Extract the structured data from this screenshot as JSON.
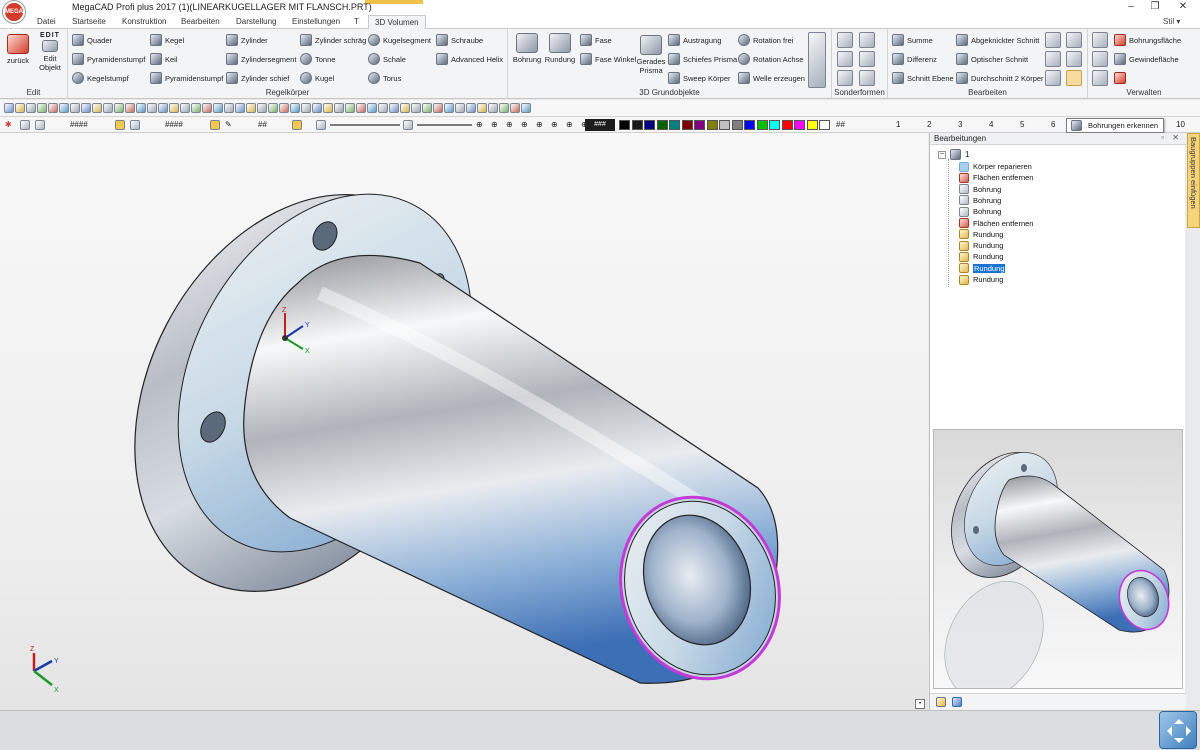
{
  "app": {
    "logo": "MEGA CAD",
    "title": "MegaCAD Profi plus 2017 (1)(LINEARKUGELLAGER MIT FLANSCH.PRT)",
    "window_buttons": [
      "–",
      "❐",
      "✕"
    ]
  },
  "menu": {
    "tabs": [
      "Datei",
      "Startseite",
      "Konstruktion",
      "Bearbeiten",
      "Darstellung",
      "Einstellungen",
      "T",
      "3D Volumen"
    ],
    "active_tab": "3D Volumen",
    "style_label": "Stil"
  },
  "ribbon": {
    "edit": {
      "label": "Edit",
      "back": "zurück",
      "edit_badge": "EDIT",
      "edit_object": "Edit Objekt"
    },
    "regelkoerper": {
      "label": "Regelkörper",
      "items": [
        "Quader",
        "Pyramidenstumpf",
        "Kegelstumpf",
        "Kegel",
        "Keil",
        "Pyramidenstumpf",
        "Zylinder",
        "Zylindersegment",
        "Zylinder schief",
        "Zylinder schräg",
        "Tonne",
        "Kugel",
        "Kugelsegment",
        "Schale",
        "Torus",
        "Schraube",
        "Advanced Helix"
      ]
    },
    "grundobjekte": {
      "label": "3D Grundobjekte",
      "items": [
        "Bohrung",
        "Rundung",
        "Fase",
        "Fase Winkel",
        "Gerades Prisma",
        "Austragung",
        "Schiefes Prisma",
        "Sweep Körper",
        "Rotation frei",
        "Rotation Achse",
        "Welle erzeugen"
      ]
    },
    "sonderformen": {
      "label": "Sonderformen"
    },
    "bearbeiten": {
      "label": "Bearbeiten",
      "items": [
        "Summe",
        "Differenz",
        "Schnitt Ebene",
        "Abgeknickter Schnitt",
        "Optischer Schnitt",
        "Durchschnitt 2 Körper"
      ]
    },
    "verwalten": {
      "label": "Verwalten",
      "items": [
        "Bohrungsfläche",
        "Gewindefläche"
      ]
    }
  },
  "toolbar2": {
    "fields": [
      "####",
      "####",
      "##"
    ],
    "color_hash": "###",
    "hash_label": "##",
    "layer_numbers": [
      "1",
      "2",
      "3",
      "4",
      "5",
      "6",
      "10"
    ],
    "palette": [
      "#000000",
      "#1a1a1a",
      "#000080",
      "#006400",
      "#008080",
      "#800000",
      "#800080",
      "#808000",
      "#c0c0c0",
      "#808080",
      "#0000ff",
      "#00c000",
      "#00ffff",
      "#ff0000",
      "#ff00ff",
      "#ffff00",
      "#ffffff"
    ]
  },
  "tooltip": "Bohrungen erkennen",
  "panel": {
    "title": "Bearbeitungen",
    "buttons": "▫ ✕",
    "root": "1",
    "items": [
      {
        "label": "Körper reparieren",
        "icon": "fill"
      },
      {
        "label": "Flächen entfernen",
        "icon": "rem"
      },
      {
        "label": "Bohrung",
        "icon": "bohr"
      },
      {
        "label": "Bohrung",
        "icon": "bohr"
      },
      {
        "label": "Bohrung",
        "icon": "bohr"
      },
      {
        "label": "Flächen entfernen",
        "icon": "rem"
      },
      {
        "label": "Rundung",
        "icon": "rund"
      },
      {
        "label": "Rundung",
        "icon": "rund"
      },
      {
        "label": "Rundung",
        "icon": "rund"
      },
      {
        "label": "Rundung",
        "icon": "rund",
        "selected": true
      },
      {
        "label": "Rundung",
        "icon": "rund"
      }
    ]
  },
  "side_tab": "Baugruppen einfügen",
  "axes": {
    "x": "X",
    "y": "Y",
    "z": "Z"
  },
  "colors": {
    "accent": "#1a73d1",
    "edge_highlight": "#c43ad8",
    "tab_accent": "#f2c14b"
  }
}
